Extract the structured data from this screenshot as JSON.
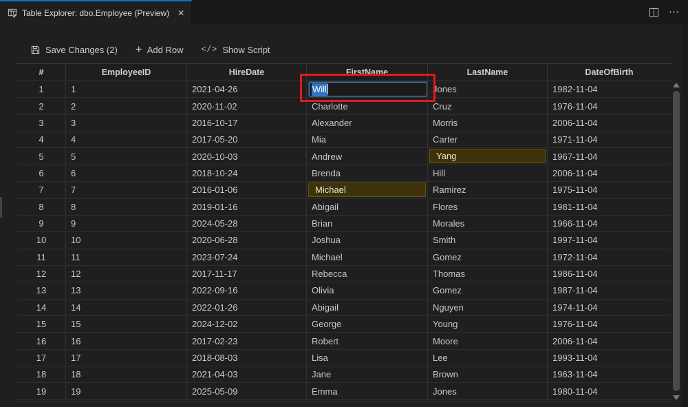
{
  "tab": {
    "title": "Table Explorer: dbo.Employee (Preview)",
    "close_glyph": "✕",
    "icon": "table-edit-icon"
  },
  "window_actions": {
    "split_editor_icon": "split-editor-icon",
    "more_glyph": "⋯",
    "more_icon": "ellipsis-icon"
  },
  "toolbar": {
    "save_label": "Save Changes (2)",
    "save_icon": "floppy-icon",
    "add_row_label": "Add Row",
    "add_row_glyph": "+",
    "show_script_label": "Show Script",
    "show_script_glyph": "</>"
  },
  "grid": {
    "columns": [
      "#",
      "EmployeeID",
      "HireDate",
      "FirstName",
      "LastName",
      "DateOfBirth"
    ],
    "edit": {
      "value": "Will",
      "column": "FirstName",
      "row": 1
    },
    "rows": [
      {
        "num": "1",
        "employee_id": "1",
        "hire_date": "2021-04-26",
        "first_name": "",
        "last_name": "Jones",
        "date_of_birth": "1982-11-04",
        "editing_first": true,
        "modified": null
      },
      {
        "num": "2",
        "employee_id": "2",
        "hire_date": "2020-11-02",
        "first_name": "Charlotte",
        "last_name": "Cruz",
        "date_of_birth": "1976-11-04",
        "editing_first": false,
        "modified": null
      },
      {
        "num": "3",
        "employee_id": "3",
        "hire_date": "2016-10-17",
        "first_name": "Alexander",
        "last_name": "Morris",
        "date_of_birth": "2006-11-04",
        "editing_first": false,
        "modified": null
      },
      {
        "num": "4",
        "employee_id": "4",
        "hire_date": "2017-05-20",
        "first_name": "Mia",
        "last_name": "Carter",
        "date_of_birth": "1971-11-04",
        "editing_first": false,
        "modified": null
      },
      {
        "num": "5",
        "employee_id": "5",
        "hire_date": "2020-10-03",
        "first_name": "Andrew",
        "last_name": "Yang",
        "date_of_birth": "1967-11-04",
        "editing_first": false,
        "modified": "last_name"
      },
      {
        "num": "6",
        "employee_id": "6",
        "hire_date": "2018-10-24",
        "first_name": "Brenda",
        "last_name": "Hill",
        "date_of_birth": "2006-11-04",
        "editing_first": false,
        "modified": null
      },
      {
        "num": "7",
        "employee_id": "7",
        "hire_date": "2016-01-06",
        "first_name": "Michael",
        "last_name": "Ramirez",
        "date_of_birth": "1975-11-04",
        "editing_first": false,
        "modified": "first_name"
      },
      {
        "num": "8",
        "employee_id": "8",
        "hire_date": "2019-01-16",
        "first_name": "Abigail",
        "last_name": "Flores",
        "date_of_birth": "1981-11-04",
        "editing_first": false,
        "modified": null
      },
      {
        "num": "9",
        "employee_id": "9",
        "hire_date": "2024-05-28",
        "first_name": "Brian",
        "last_name": "Morales",
        "date_of_birth": "1966-11-04",
        "editing_first": false,
        "modified": null
      },
      {
        "num": "10",
        "employee_id": "10",
        "hire_date": "2020-06-28",
        "first_name": "Joshua",
        "last_name": "Smith",
        "date_of_birth": "1997-11-04",
        "editing_first": false,
        "modified": null
      },
      {
        "num": "11",
        "employee_id": "11",
        "hire_date": "2023-07-24",
        "first_name": "Michael",
        "last_name": "Gomez",
        "date_of_birth": "1972-11-04",
        "editing_first": false,
        "modified": null
      },
      {
        "num": "12",
        "employee_id": "12",
        "hire_date": "2017-11-17",
        "first_name": "Rebecca",
        "last_name": "Thomas",
        "date_of_birth": "1986-11-04",
        "editing_first": false,
        "modified": null
      },
      {
        "num": "13",
        "employee_id": "13",
        "hire_date": "2022-09-16",
        "first_name": "Olivia",
        "last_name": "Gomez",
        "date_of_birth": "1987-11-04",
        "editing_first": false,
        "modified": null
      },
      {
        "num": "14",
        "employee_id": "14",
        "hire_date": "2022-01-26",
        "first_name": "Abigail",
        "last_name": "Nguyen",
        "date_of_birth": "1974-11-04",
        "editing_first": false,
        "modified": null
      },
      {
        "num": "15",
        "employee_id": "15",
        "hire_date": "2024-12-02",
        "first_name": "George",
        "last_name": "Young",
        "date_of_birth": "1976-11-04",
        "editing_first": false,
        "modified": null
      },
      {
        "num": "16",
        "employee_id": "16",
        "hire_date": "2017-02-23",
        "first_name": "Robert",
        "last_name": "Moore",
        "date_of_birth": "2006-11-04",
        "editing_first": false,
        "modified": null
      },
      {
        "num": "17",
        "employee_id": "17",
        "hire_date": "2018-08-03",
        "first_name": "Lisa",
        "last_name": "Lee",
        "date_of_birth": "1993-11-04",
        "editing_first": false,
        "modified": null
      },
      {
        "num": "18",
        "employee_id": "18",
        "hire_date": "2021-04-03",
        "first_name": "Jane",
        "last_name": "Brown",
        "date_of_birth": "1963-11-04",
        "editing_first": false,
        "modified": null
      },
      {
        "num": "19",
        "employee_id": "19",
        "hire_date": "2025-05-09",
        "first_name": "Emma",
        "last_name": "Jones",
        "date_of_birth": "1980-11-04",
        "editing_first": false,
        "modified": null
      }
    ]
  },
  "colors": {
    "accent": "#0078d4",
    "modified_cell_bg": "#3e3308",
    "modified_cell_border": "#645515",
    "selection_bg": "#3173c5",
    "annotation_red": "#e01b1b",
    "editor_border": "#4d7dad"
  }
}
